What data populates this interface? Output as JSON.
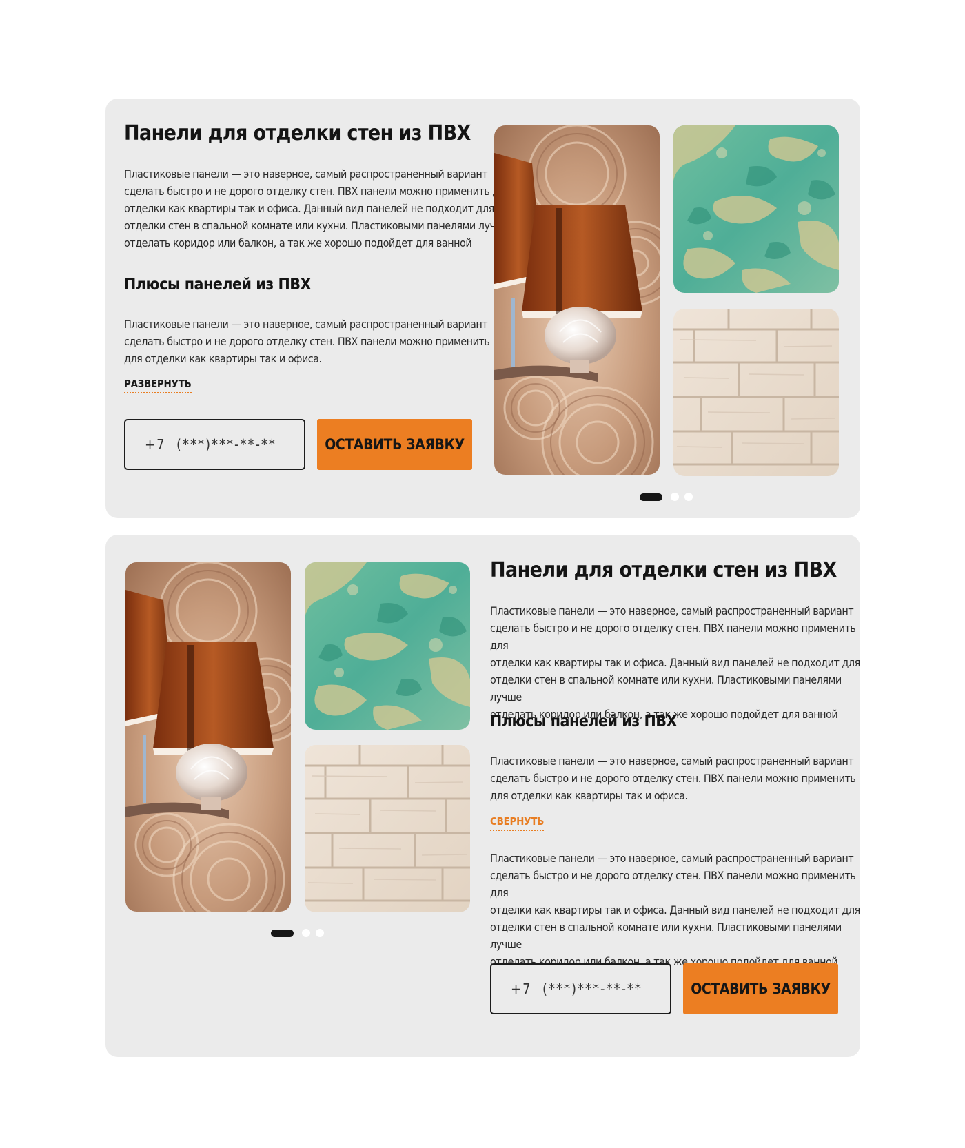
{
  "sections": [
    {
      "title": "Панели для отделки стен из ПВХ",
      "intro_lines": [
        "Пластиковые панели — это наверное, самый распространенный вариант",
        "сделать быстро и не дорого отделку стен. ПВХ панели можно применить для",
        "отделки как квартиры так и офиса. Данный вид панелей не подходит для",
        "отделки стен в спальной комнате или кухни. Пластиковыми панелями лучше",
        "отделать коридор или балкон, а так же хорошо подойдет для ванной"
      ],
      "pros_title": "Плюсы панелей из ПВХ",
      "pros_lines": [
        "Пластиковые панели — это наверное, самый распространенный вариант",
        "сделать быстро и не дорого отделку стен. ПВХ панели можно применить",
        "для отделки как квартиры так и офиса."
      ],
      "toggle_label": "РАЗВЕРНУТЬ",
      "phone_placeholder": "+7  (***)***-**-**",
      "submit_label": "ОСТАВИТЬ ЗАЯВКУ",
      "gallery": [
        "lamp-photo",
        "turquoise-plaster-photo",
        "white-brick-panel-photo"
      ],
      "slider_pages": 3,
      "slider_active": 1
    },
    {
      "title": "Панели для отделки стен из ПВХ",
      "intro_lines": [
        "Пластиковые панели — это наверное, самый распространенный вариант",
        "сделать быстро и не дорого отделку стен. ПВХ панели можно применить для",
        "отделки как квартиры так и офиса. Данный вид панелей не подходит для",
        "отделки стен в спальной комнате или кухни. Пластиковыми панелями лучше",
        "отделать коридор или балкон, а так же хорошо подойдет для ванной"
      ],
      "pros_title": "Плюсы панелей из ПВХ",
      "pros_lines": [
        "Пластиковые панели — это наверное, самый распространенный вариант",
        "сделать быстро и не дорого отделку стен. ПВХ панели можно применить",
        "для отделки как квартиры так и офиса."
      ],
      "toggle_label": "СВЕРНУТЬ",
      "expanded_lines": [
        "Пластиковые панели — это наверное, самый распространенный вариант",
        "сделать быстро и не дорого отделку стен. ПВХ панели можно применить для",
        "отделки как квартиры так и офиса. Данный вид панелей не подходит для",
        "отделки стен в спальной комнате или кухни. Пластиковыми панелями лучше",
        "отделать коридор или балкон, а так же хорошо подойдет для ванной"
      ],
      "phone_placeholder": "+7  (***)***-**-**",
      "submit_label": "ОСТАВИТЬ ЗАЯВКУ",
      "gallery": [
        "lamp-photo",
        "turquoise-plaster-photo",
        "white-brick-panel-photo"
      ],
      "slider_pages": 3,
      "slider_active": 1
    }
  ],
  "colors": {
    "accent": "#ec7e22",
    "card_background": "#ebebeb",
    "text": "#141414",
    "dot_active": "#161616",
    "dot_inactive": "#ffffff"
  }
}
